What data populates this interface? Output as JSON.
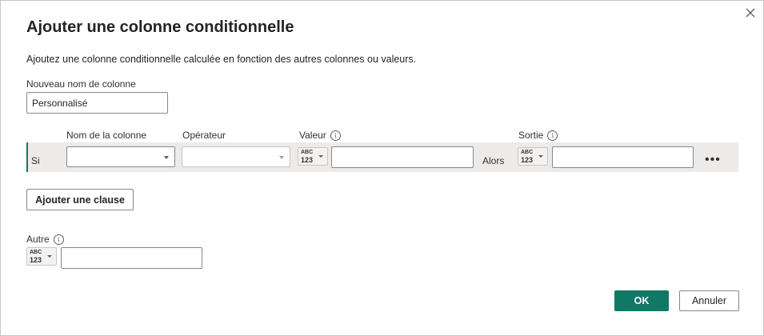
{
  "dialog": {
    "title": "Ajouter une colonne conditionnelle",
    "description": "Ajoutez une colonne conditionnelle calculée en fonction des autres colonnes ou valeurs.",
    "new_column_label": "Nouveau nom de colonne",
    "new_column_value": "Personnalisé"
  },
  "clause_headers": {
    "column_name": "Nom de la colonne",
    "operator": "Opérateur",
    "value": "Valeur",
    "output": "Sortie"
  },
  "clause_row": {
    "if_label": "Si",
    "then_label": "Alors",
    "column_value": "",
    "operator_value": "",
    "value_input": "",
    "output_input": "",
    "type_selector": {
      "line1": "ABC",
      "line2": "123"
    },
    "more_label": "•••"
  },
  "add_clause_button": "Ajouter une clause",
  "else_section": {
    "label": "Autre",
    "value": "",
    "type_selector": {
      "line1": "ABC",
      "line2": "123"
    }
  },
  "footer": {
    "ok_label": "OK",
    "cancel_label": "Annuler"
  },
  "colors": {
    "accent": "#117865",
    "row_background": "#edebe9"
  },
  "icons": [
    "close-icon",
    "info-icon",
    "chevron-down-icon",
    "data-type-icon",
    "more-options-icon"
  ]
}
